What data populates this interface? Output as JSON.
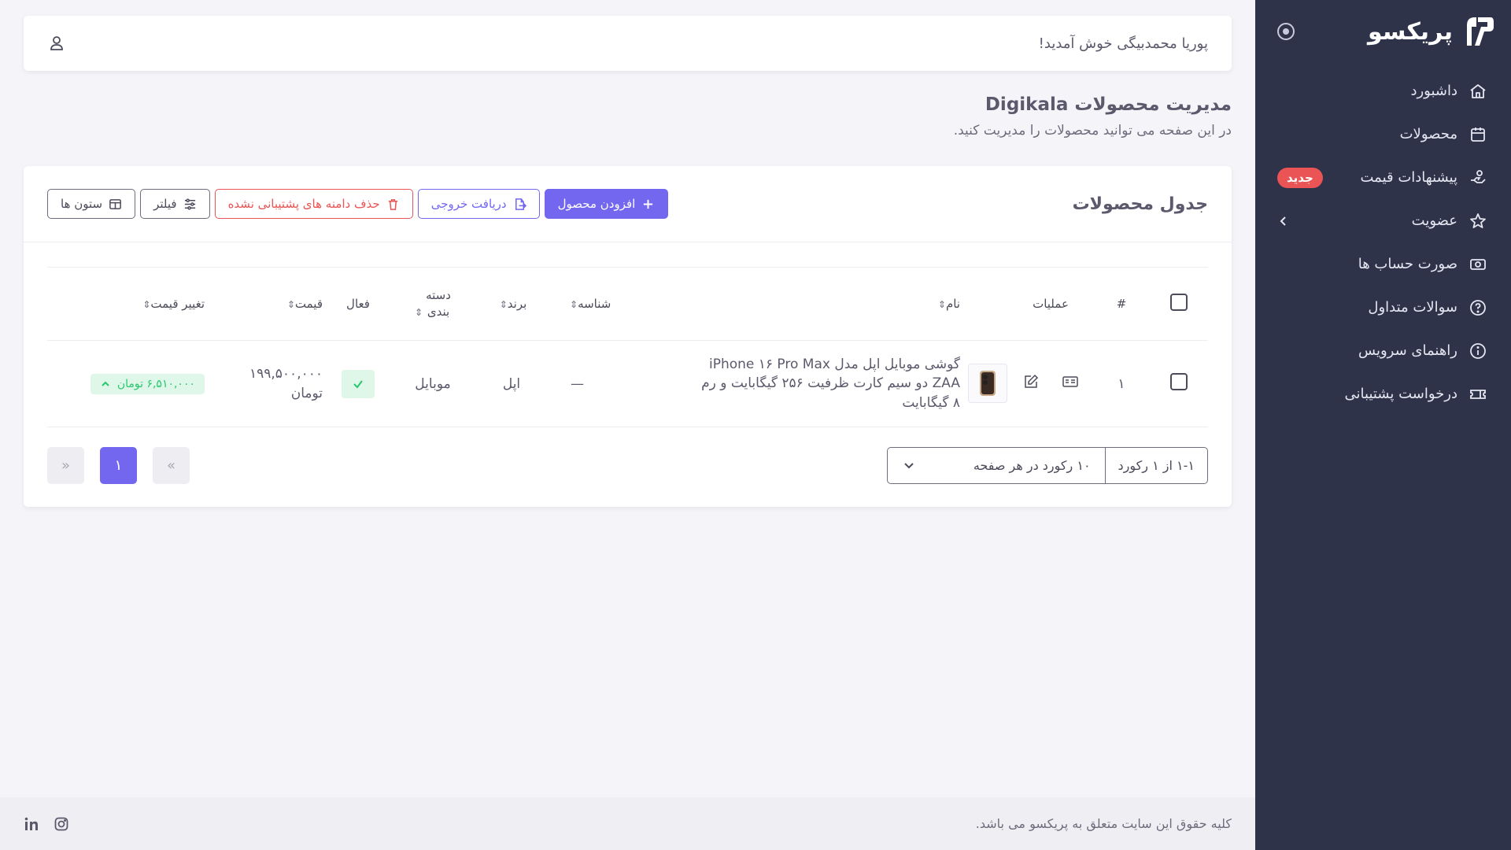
{
  "sidebar": {
    "brand": "پریکسو",
    "items": [
      {
        "label": "داشبورد",
        "icon": "home-icon"
      },
      {
        "label": "محصولات",
        "icon": "calendar-icon"
      },
      {
        "label": "پیشنهادات قیمت",
        "icon": "price-offer-icon",
        "badge": "جدید"
      },
      {
        "label": "عضویت",
        "icon": "star-icon"
      },
      {
        "label": "صورت حساب ها",
        "icon": "cash-icon"
      },
      {
        "label": "سوالات متداول",
        "icon": "help-icon"
      },
      {
        "label": "راهنمای سرویس",
        "icon": "info-icon"
      },
      {
        "label": "درخواست پشتیبانی",
        "icon": "ticket-icon"
      }
    ]
  },
  "topbar": {
    "welcome": "پوریا محمدبیگی خوش آمدید!"
  },
  "page": {
    "title": "مدیریت محصولات Digikala",
    "subtitle": "در این صفحه می توانید محصولات را مدیریت کنید."
  },
  "card": {
    "title": "جدول محصولات",
    "buttons": {
      "columns": "ستون ها",
      "filter": "فیلتر",
      "delete_unsupported": "حذف دامنه های پشتیبانی نشده",
      "export": "دریافت خروجی",
      "add_product": "افزودن محصول"
    }
  },
  "table": {
    "headers": {
      "index": "#",
      "operations": "عملیات",
      "name": "نام",
      "id": "شناسه",
      "brand": "برند",
      "category": "دسته بندی",
      "active": "فعال",
      "price": "قیمت",
      "price_change": "تغییر قیمت"
    },
    "rows": [
      {
        "index": "۱",
        "name": "گوشی موبایل اپل مدل iPhone ۱۶ Pro Max ZAA دو سیم کارت ظرفیت ۲۵۶ گیگابایت و رم ۸ گیگابایت",
        "id": "—",
        "brand": "اپل",
        "category": "موبایل",
        "price": "۱۹۹,۵۰۰,۰۰۰ تومان",
        "price_change": "۶,۵۱۰,۰۰۰ تومان"
      }
    ]
  },
  "pager": {
    "records": "۱-۱ از ۱ رکورد",
    "per_page": "۱۰ رکورد در هر صفحه",
    "prev": "«",
    "current": "۱",
    "next": "»"
  },
  "footer": {
    "copyright": "کلیه حقوق این سایت متعلق به پریکسو می باشد."
  },
  "colors": {
    "primary": "#7367f0",
    "danger": "#ea5455",
    "success": "#28c76f",
    "sidebar": "#2f3349"
  }
}
